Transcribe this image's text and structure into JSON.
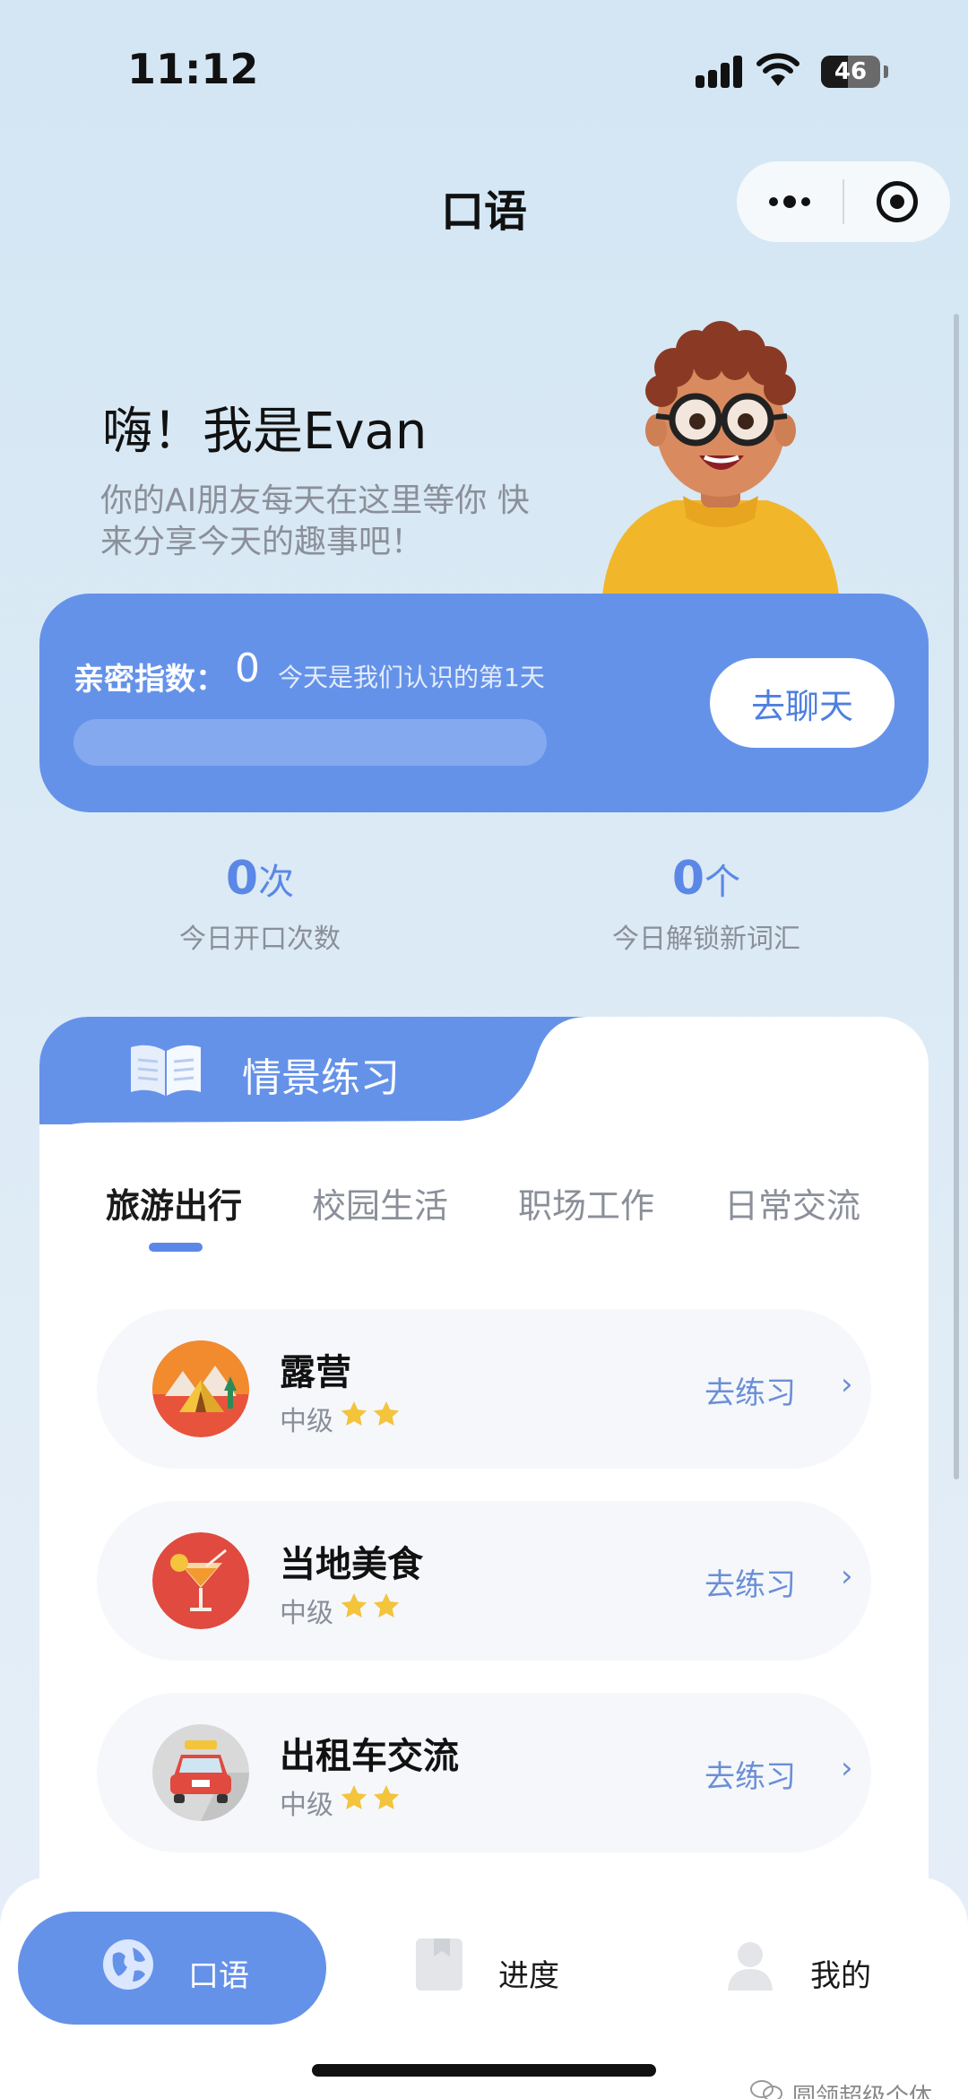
{
  "status_bar": {
    "time": "11:12",
    "battery": "46"
  },
  "nav": {
    "title": "口语"
  },
  "greeting": {
    "title": "嗨！我是Evan",
    "subtitle_line1": "你的AI朋友每天在这里等你 快",
    "subtitle_line2": "来分享今天的趣事吧！"
  },
  "intimacy": {
    "label": "亲密指数：",
    "value": "0",
    "days_text": "今天是我们认识的第1天",
    "progress": 0,
    "chat_button": "去聊天"
  },
  "stats": [
    {
      "value": "0",
      "unit": "次",
      "label": "今日开口次数"
    },
    {
      "value": "0",
      "unit": "个",
      "label": "今日解锁新词汇"
    }
  ],
  "practice": {
    "title": "情景练习",
    "categories": [
      "旅游出行",
      "校园生活",
      "职场工作",
      "日常交流"
    ],
    "active_category": 0,
    "items": [
      {
        "title": "露营",
        "level": "中级",
        "stars": 2,
        "action": "去练习",
        "icon": "camping-tent-icon"
      },
      {
        "title": "当地美食",
        "level": "中级",
        "stars": 2,
        "action": "去练习",
        "icon": "cocktail-icon"
      },
      {
        "title": "出租车交流",
        "level": "中级",
        "stars": 2,
        "action": "去练习",
        "icon": "taxi-icon"
      }
    ]
  },
  "tabbar": {
    "items": [
      {
        "label": "口语",
        "icon": "globe-icon",
        "active": true
      },
      {
        "label": "进度",
        "icon": "bookmark-icon",
        "active": false
      },
      {
        "label": "我的",
        "icon": "user-icon",
        "active": false
      }
    ]
  },
  "watermark": "圆领超级个体",
  "colors": {
    "accent": "#6592e9",
    "accent_text": "#5b88e6",
    "star": "#f3c43c"
  }
}
